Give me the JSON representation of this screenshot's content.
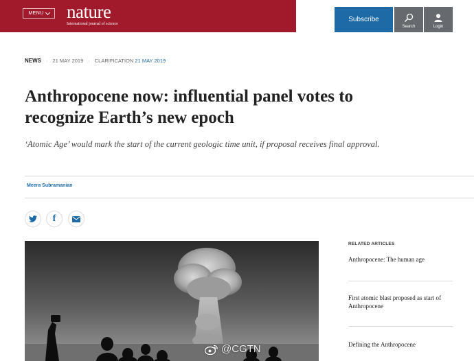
{
  "header": {
    "menu_label": "MENU",
    "logo_word": "nature",
    "logo_tagline": "International journal of science",
    "subscribe_label": "Subscribe",
    "search_label": "Search",
    "login_label": "Login",
    "brand_color": "#a11a2c",
    "accent_color": "#1d6aa6"
  },
  "article": {
    "type": "NEWS",
    "published": "21 MAY 2019",
    "clarification_label": "CLARIFICATION",
    "clarification_date": "21 MAY 2019",
    "title": "Anthropocene now: influential panel votes to recognize Earth’s new epoch",
    "standfirst": "‘Atomic Age’ would mark the start of the current geologic time unit, if proposal receives final approval.",
    "author": "Meera Subramanian"
  },
  "share": {
    "icons": [
      "twitter-icon",
      "facebook-icon",
      "email-icon"
    ]
  },
  "related": {
    "heading": "RELATED ARTICLES",
    "items": [
      "Anthropocene: The human age",
      "First atomic blast proposed as start of Anthropocene",
      "Defining the Anthropocene"
    ]
  },
  "watermark": {
    "text": "@CGTN",
    "icon": "weibo-icon"
  }
}
